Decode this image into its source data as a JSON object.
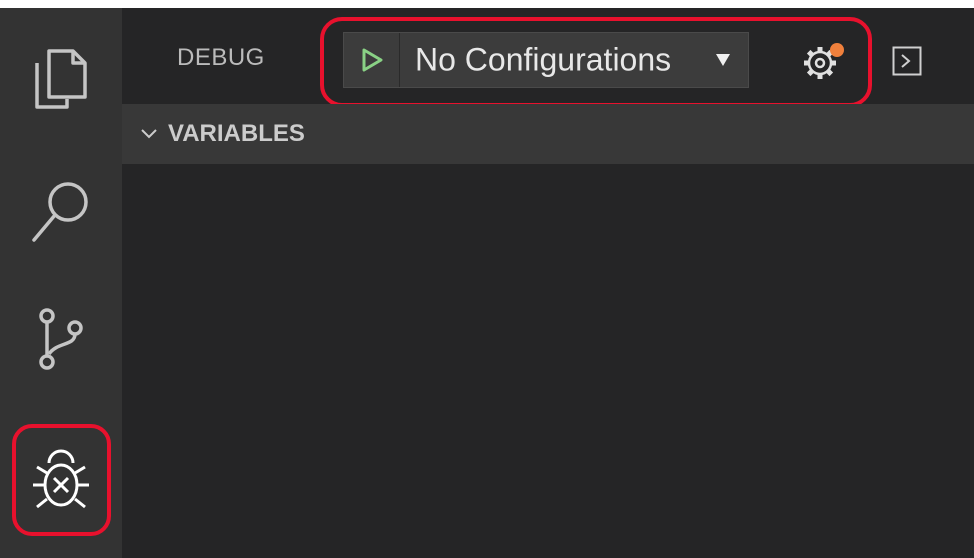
{
  "colors": {
    "activity_bar": "#333333",
    "sidebar": "#252526",
    "section_header": "#383838",
    "highlight": "#e8112d",
    "start_icon": "#89d185",
    "badge": "#f0803c"
  },
  "activity_bar": {
    "items": [
      {
        "icon": "files-icon"
      },
      {
        "icon": "search-icon"
      },
      {
        "icon": "source-control-icon"
      },
      {
        "icon": "debug-icon",
        "active": true
      }
    ]
  },
  "debug_view": {
    "title": "DEBUG",
    "toolbar": {
      "start_icon": "play-icon",
      "configuration": "No Configurations",
      "settings_icon": "gear-icon",
      "console_icon": "debug-console-icon"
    },
    "sections": [
      {
        "title": "VARIABLES",
        "expanded": true
      }
    ]
  }
}
